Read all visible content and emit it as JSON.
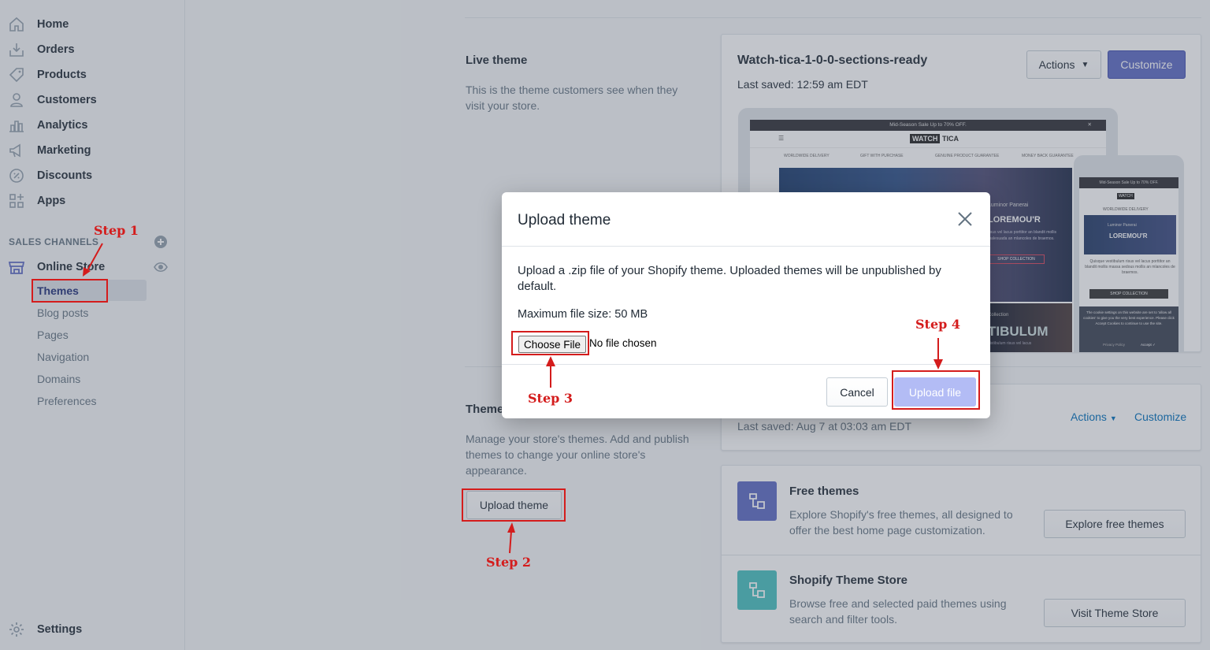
{
  "sidebar": {
    "items": [
      {
        "label": "Home",
        "icon": "home-icon"
      },
      {
        "label": "Orders",
        "icon": "orders-icon"
      },
      {
        "label": "Products",
        "icon": "tag-icon"
      },
      {
        "label": "Customers",
        "icon": "person-icon"
      },
      {
        "label": "Analytics",
        "icon": "bar-chart-icon"
      },
      {
        "label": "Marketing",
        "icon": "megaphone-icon"
      },
      {
        "label": "Discounts",
        "icon": "discount-icon"
      },
      {
        "label": "Apps",
        "icon": "apps-icon"
      }
    ],
    "sales_channels_header": "SALES CHANNELS",
    "online_store_label": "Online Store",
    "online_store_sub": [
      "Themes",
      "Blog posts",
      "Pages",
      "Navigation",
      "Domains",
      "Preferences"
    ],
    "settings_label": "Settings"
  },
  "live_theme": {
    "section_title": "Live theme",
    "section_desc": "This is the theme customers see when they visit your store.",
    "theme_name": "Watch-tica-1-0-0-sections-ready",
    "last_saved": "Last saved: 12:59 am EDT",
    "actions_label": "Actions",
    "customize_label": "Customize"
  },
  "preview": {
    "promo": "Mid-Season Sale Up to 70% OFF.",
    "logo_left": "WATCH",
    "logo_right": "TICA",
    "features": [
      "WORLDWIDE DELIVERY",
      "GIFT WITH PURCHASE",
      "GENUINE PRODUCT GUARANTEE",
      "MONEY BACK GUARANTEE"
    ],
    "hero_small": "Luminor Panerai",
    "hero_big": "LOREMOU'R",
    "hero_text": "risus vel lacus porttitor an blandit mollis malesuada an mlancoles de braemos.",
    "hero_btn": "SHOP COLLECTION",
    "bottom_big": "TIBULUM",
    "bottom_small": "distibulum risus vel lacus",
    "collection_label": "Collection",
    "mobile_feature": "WORLDWIDE DELIVERY",
    "mobile_text": "Quisque vestibulum risus vel lacus porttitor an blandit mollis massa sedous mollis an mlancoles de braemos.",
    "mobile_btn": "SHOP COLLECTION",
    "cookie_text": "The cookie settings on this website are set to 'allow all cookies' to give you the very best experience. Please click Accept Cookies to continue to use the site.",
    "privacy": "Privacy Policy",
    "accept": "Accept ✓",
    "close": "✕"
  },
  "themes_section": {
    "title": "Theme",
    "desc": "Manage your store's themes. Add and publish themes to change your online store's appearance.",
    "upload_label": "Upload theme",
    "library_last_saved": "Last saved: Aug 7 at 03:03 am EDT",
    "library_actions": "Actions",
    "library_customize": "Customize"
  },
  "free_themes": {
    "title": "Free themes",
    "desc": "Explore Shopify's free themes, all designed to offer the best home page customization.",
    "button": "Explore free themes",
    "icon_color": "#5c6ac4"
  },
  "theme_store": {
    "title": "Shopify Theme Store",
    "desc": "Browse free and selected paid themes using search and filter tools.",
    "button": "Visit Theme Store",
    "icon_color": "#47c1bf"
  },
  "modal": {
    "title": "Upload theme",
    "desc": "Upload a .zip file of your Shopify theme. Uploaded themes will be unpublished by default.",
    "max_size": "Maximum file size: 50 MB",
    "choose_file": "Choose File",
    "no_file": "No file chosen",
    "cancel": "Cancel",
    "upload": "Upload file"
  },
  "annotations": {
    "step1": "Step 1",
    "step2": "Step 2",
    "step3": "Step 3",
    "step4": "Step 4",
    "color": "#d41c1c"
  }
}
